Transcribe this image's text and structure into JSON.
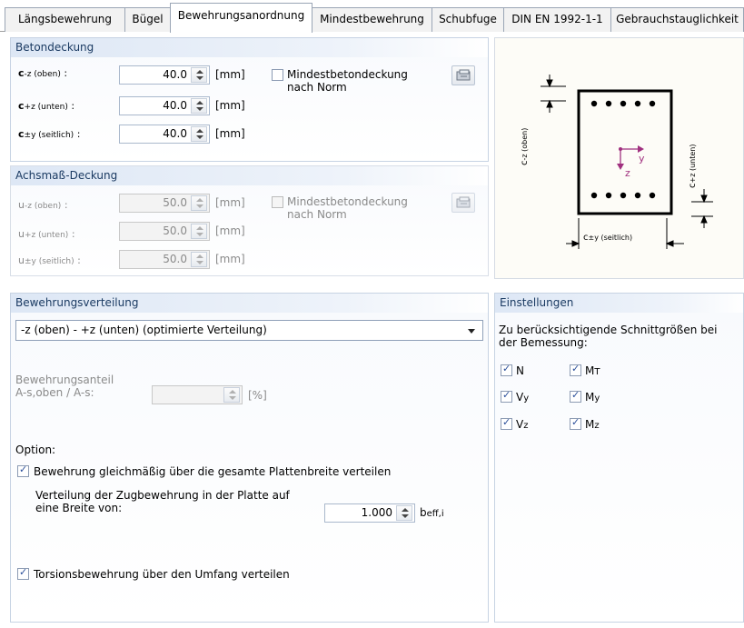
{
  "tabs": [
    {
      "label": "Längsbewehrung"
    },
    {
      "label": "Bügel"
    },
    {
      "label": "Bewehrungsanordnung"
    },
    {
      "label": "Mindestbewehrung"
    },
    {
      "label": "Schubfuge"
    },
    {
      "label": "DIN EN 1992-1-1"
    },
    {
      "label": "Gebrauchstauglichkeit"
    }
  ],
  "betondeckung": {
    "title": "Betondeckung",
    "rows": [
      {
        "sym": "c",
        "sub": "-z (oben)",
        "sep": ":",
        "value": "40.0",
        "unit": "[mm]"
      },
      {
        "sym": "c",
        "sub": "+z (unten)",
        "sep": ":",
        "value": "40.0",
        "unit": "[mm]"
      },
      {
        "sym": "c",
        "sub": "±y (seitlich)",
        "sep": ":",
        "value": "40.0",
        "unit": "[mm]"
      }
    ],
    "mindest_label": "Mindestbetondeckung nach Norm"
  },
  "achsmass": {
    "title": "Achsmaß-Deckung",
    "rows": [
      {
        "sym": "u",
        "sub": "-z (oben)",
        "sep": ":",
        "value": "50.0",
        "unit": "[mm]"
      },
      {
        "sym": "u",
        "sub": "+z (unten)",
        "sep": ":",
        "value": "50.0",
        "unit": "[mm]"
      },
      {
        "sym": "u",
        "sub": "±y (seitlich)",
        "sep": ":",
        "value": "50.0",
        "unit": "[mm]"
      }
    ],
    "mindest_label": "Mindestbetondeckung nach Norm"
  },
  "diagram": {
    "label_top_sym": "c",
    "label_top_sub": "-z (oben)",
    "label_bottom_sym": "c",
    "label_bottom_sub": "+z (unten)",
    "label_side_sym": "c",
    "label_side_sub": "±y (seitlich)",
    "axis_y": "y",
    "axis_z": "z",
    "colors": {
      "bar": "#000000",
      "axis": "#a0307f",
      "section": "#000000"
    }
  },
  "verteilung": {
    "title": "Bewehrungsverteilung",
    "selected": "-z (oben) - +z (unten) (optimierte Verteilung)",
    "anteil_label_1": "Bewehrungsanteil",
    "anteil_label_2": "A-s,oben / A-s:",
    "anteil_value": "",
    "anteil_unit": "[%]",
    "option_label": "Option:",
    "gleichmaessig_label": "Bewehrung gleichmäßig über die gesamte Plattenbreite verteilen",
    "zug_label_1": "Verteilung der Zugbewehrung in der Platte auf",
    "zug_label_2": "eine Breite von:",
    "zug_value": "1.000",
    "zug_unit_sym": "b",
    "zug_unit_sub": "eff,i",
    "torsion_label": "Torsionsbewehrung über den Umfang verteilen"
  },
  "einstellungen": {
    "title": "Einstellungen",
    "desc_1": "Zu berücksichtigende Schnittgrößen bei",
    "desc_2": "der Bemessung:",
    "forces": [
      {
        "sym": "N",
        "sub": ""
      },
      {
        "sym": "M",
        "sub": "T"
      },
      {
        "sym": "V",
        "sub": "y"
      },
      {
        "sym": "M",
        "sub": "y"
      },
      {
        "sym": "V",
        "sub": "z"
      },
      {
        "sym": "M",
        "sub": "z"
      }
    ]
  }
}
